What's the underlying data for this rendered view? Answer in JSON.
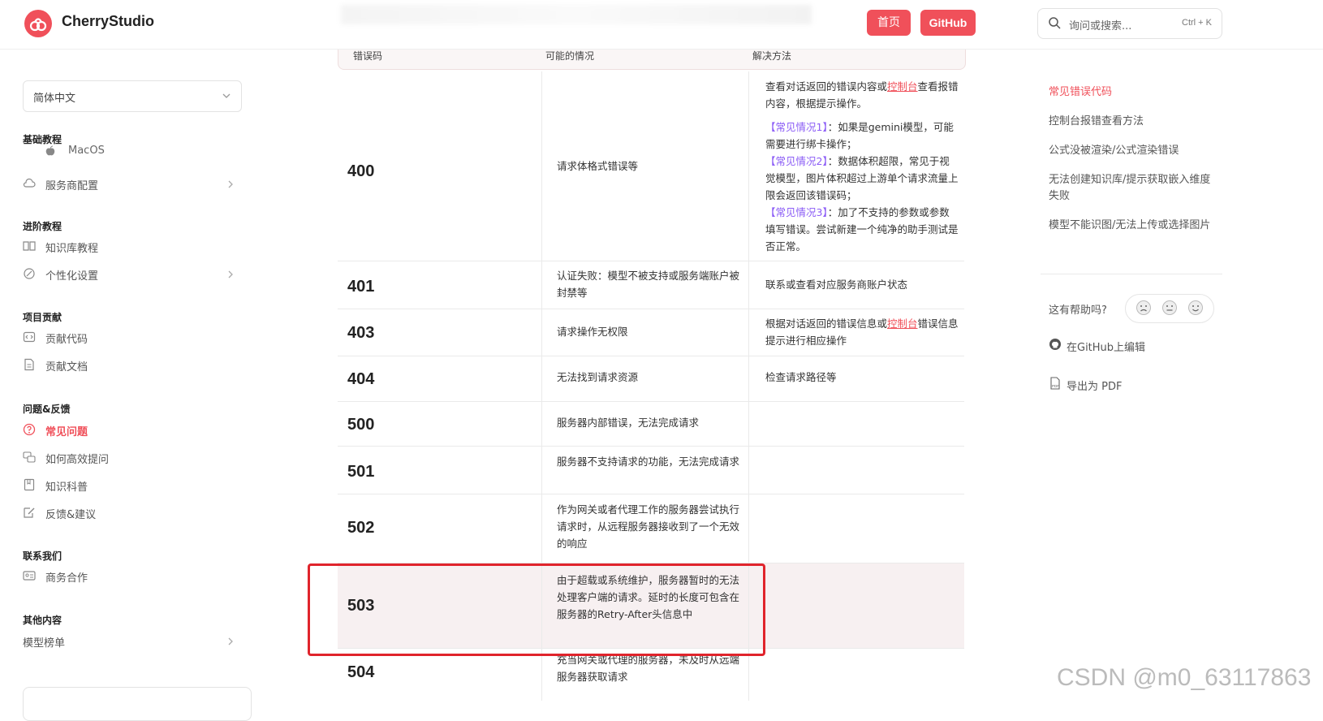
{
  "header": {
    "brand": "CherryStudio",
    "home_label": "首页",
    "github_label": "GitHub",
    "search_placeholder": "询问或搜索...",
    "search_shortcut": "Ctrl + K"
  },
  "sidebar": {
    "language": "简体中文",
    "sections": {
      "basic": "基础教程",
      "advanced": "进阶教程",
      "contribute": "项目贡献",
      "feedback": "问题&反馈",
      "contact": "联系我们",
      "other": "其他内容"
    },
    "items": {
      "macos": "MacOS",
      "provider_config": "服务商配置",
      "knowledge_tutorial": "知识库教程",
      "personalize": "个性化设置",
      "contribute_code": "贡献代码",
      "contribute_docs": "贡献文档",
      "faq": "常见问题",
      "ask_effectively": "如何高效提问",
      "knowledge_science": "知识科普",
      "feedback_suggest": "反馈&建议",
      "business": "商务合作",
      "model_ranking": "模型榜单"
    }
  },
  "table": {
    "headers": [
      "错误码",
      "可能的情况",
      "解决方法"
    ],
    "rows": [
      {
        "code": "400",
        "desc": "请求体格式错误等"
      },
      {
        "code": "401",
        "desc": "认证失败：模型不被支持或服务端账户被封禁等",
        "sol": "联系或查看对应服务商账户状态"
      },
      {
        "code": "403",
        "desc": "请求操作无权限"
      },
      {
        "code": "404",
        "desc": "无法找到请求资源",
        "sol": "检查请求路径等"
      },
      {
        "code": "500",
        "desc": "服务器内部错误，无法完成请求"
      },
      {
        "code": "501",
        "desc": "服务器不支持请求的功能，无法完成请求"
      },
      {
        "code": "502",
        "desc": "作为网关或者代理工作的服务器尝试执行请求时，从远程服务器接收到了一个无效的响应"
      },
      {
        "code": "503",
        "desc": "由于超载或系统维护，服务器暂时的无法处理客户端的请求。延时的长度可包含在服务器的Retry-After头信息中"
      },
      {
        "code": "504",
        "desc": "充当网关或代理的服务器，未及时从远端服务器获取请求"
      }
    ],
    "sol400": {
      "a": "查看对话返回的错误内容或",
      "link": "控制台",
      "b": "查看报错内容，根据提示操作。",
      "c1_tag": "【常见情况1】",
      "c1": "：如果是gemini模型，可能需要进行绑卡操作；",
      "c2_tag": "【常见情况2】",
      "c2": "：数据体积超限，常见于视觉模型，图片体积超过上游单个请求流量上限会返回该错误码；",
      "c3_tag": "【常见情况3】",
      "c3": "：加了不支持的参数或参数填写错误。尝试新建一个纯净的助手测试是否正常。"
    },
    "sol403": {
      "a": "根据对话返回的错误信息或",
      "link": "控制台",
      "b": "错误信息提示进行相应操作"
    }
  },
  "toc": {
    "items": [
      "常见错误代码",
      "控制台报错查看方法",
      "公式没被渲染/公式渲染错误",
      "无法创建知识库/提示获取嵌入维度失败",
      "模型不能识图/无法上传或选择图片"
    ],
    "help_label": "这有帮助吗?",
    "edit_github": "在GitHub上编辑",
    "export_pdf": "导出为 PDF"
  },
  "watermark": "CSDN @m0_63117863",
  "colors": {
    "accent": "#f0505a",
    "highlight": "#e0242c",
    "tag": "#8b5cf6"
  }
}
